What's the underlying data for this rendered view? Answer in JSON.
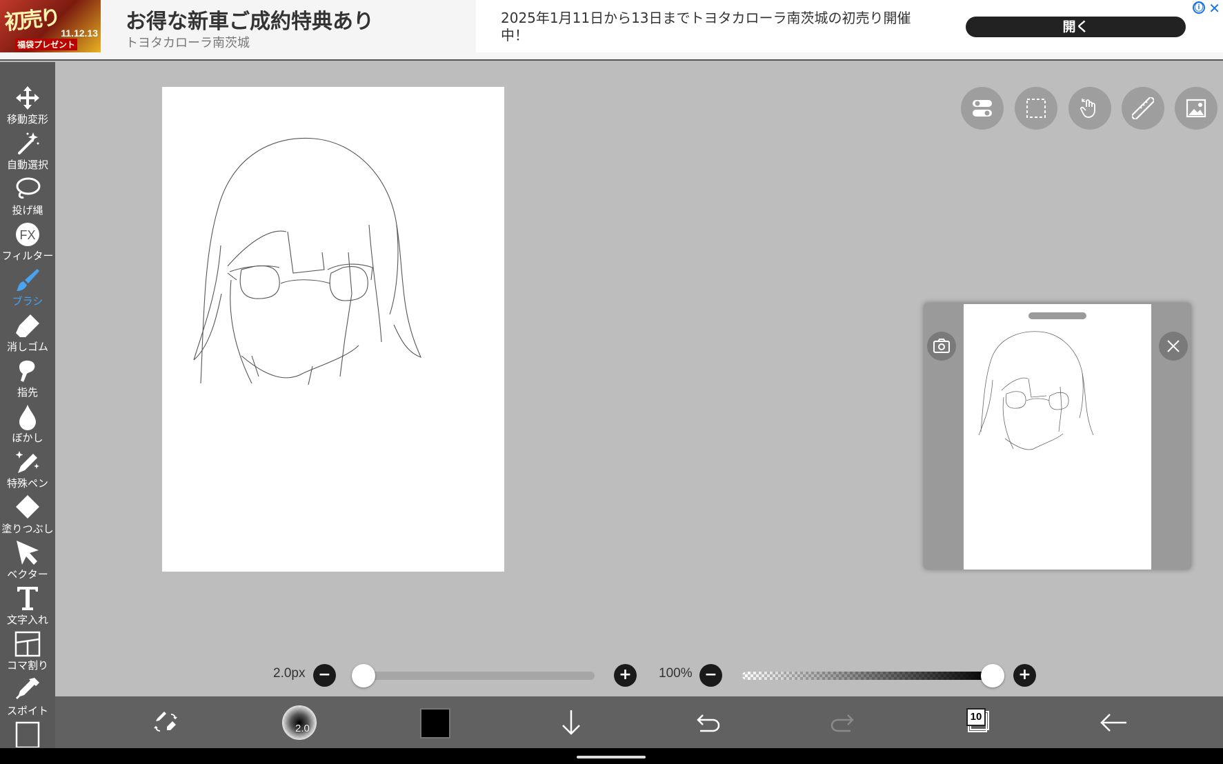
{
  "ad": {
    "thumb_text_1": "初売り",
    "thumb_text_2": "11.12.13",
    "thumb_text_3": "福袋プレゼント",
    "title": "お得な新車ご成約特典あり",
    "subtitle": "トヨタカローラ南茨城",
    "description": "2025年1月11日から13日までトヨタカローラ南茨城の初売り開催中！",
    "open_button": "開く",
    "info_icon": "ⓘ",
    "close_icon": "✕"
  },
  "sidebar": {
    "items": [
      {
        "label": "移動変形",
        "icon": "move-icon"
      },
      {
        "label": "自動選択",
        "icon": "magic-wand-icon"
      },
      {
        "label": "投げ縄",
        "icon": "lasso-icon"
      },
      {
        "label": "フィルター",
        "icon": "fx-icon"
      },
      {
        "label": "ブラシ",
        "icon": "brush-icon"
      },
      {
        "label": "消しゴム",
        "icon": "eraser-icon"
      },
      {
        "label": "指先",
        "icon": "finger-icon"
      },
      {
        "label": "ぼかし",
        "icon": "blur-drop-icon"
      },
      {
        "label": "特殊ペン",
        "icon": "special-pen-icon"
      },
      {
        "label": "塗りつぶし",
        "icon": "fill-bucket-icon"
      },
      {
        "label": "ベクター",
        "icon": "vector-cursor-icon"
      },
      {
        "label": "文字入れ",
        "icon": "text-icon"
      },
      {
        "label": "コマ割り",
        "icon": "frame-divider-icon"
      },
      {
        "label": "スポイト",
        "icon": "eyedropper-icon"
      }
    ],
    "active_index": 4,
    "active_color": "#4aa3f0"
  },
  "top_buttons": [
    "toggle-icon",
    "selection-icon",
    "hand-icon",
    "ruler-icon",
    "image-icon"
  ],
  "sliders": {
    "size_label": "2.0px",
    "size_value": 0.0,
    "opacity_label": "100%",
    "opacity_value": 1.0,
    "minus": "−",
    "plus": "+"
  },
  "bottombar": {
    "brush_size": "2.0",
    "color": "#000000",
    "layer_count": "10"
  }
}
